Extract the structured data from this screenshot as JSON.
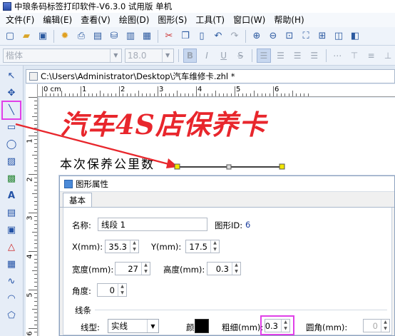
{
  "window": {
    "title": "中琅条码标签打印软件-V6.3.0 试用版 单机"
  },
  "menu": [
    "文件(F)",
    "编辑(E)",
    "查看(V)",
    "绘图(D)",
    "图形(S)",
    "工具(T)",
    "窗口(W)",
    "帮助(H)"
  ],
  "toolbar": {
    "icons": [
      "new-icon",
      "open-icon",
      "save-icon",
      "settings-icon",
      "print-icon",
      "print-preview-icon",
      "database-icon",
      "export-icon",
      "grid-icon",
      "cut-icon",
      "copy-icon",
      "paste-icon",
      "undo-icon",
      "redo-icon",
      "zoom-in-icon",
      "zoom-out-icon",
      "zoom-fit-icon",
      "zoom-page-icon",
      "zoom-actual-icon"
    ]
  },
  "format_bar": {
    "font_name": "楷体",
    "font_size": "18.0",
    "bold": "B",
    "italic": "I",
    "underline": "U",
    "strike": "S"
  },
  "document": {
    "tab_title": "C:\\Users\\Administrator\\Desktop\\汽车维修卡.zhl *"
  },
  "ruler": {
    "unit": "cm",
    "labels": [
      "0",
      "1",
      "2",
      "3",
      "4",
      "5",
      "6"
    ],
    "v_labels": [
      "1",
      "2",
      "3",
      "4",
      "5",
      "6"
    ]
  },
  "label": {
    "title": "汽车4S店保养卡",
    "line1_text": "本次保养公里数"
  },
  "dialog": {
    "title": "图形属性",
    "tab": "基本",
    "name_label": "名称:",
    "name_value": "线段 1",
    "id_label": "图形ID:",
    "id_value": "6",
    "x_label": "X(mm):",
    "x_value": "35.3",
    "y_label": "Y(mm):",
    "y_value": "17.5",
    "width_label": "宽度(mm):",
    "width_value": "27",
    "height_label": "高度(mm):",
    "height_value": "0.3",
    "angle_label": "角度:",
    "angle_value": "0",
    "line_group": "线条",
    "line_type_label": "线型:",
    "line_type_value": "实线",
    "color_label": "颜色:",
    "color_value": "#000000",
    "thickness_label": "粗细(mm):",
    "thickness_value": "0.3",
    "corner_label": "圆角(mm):",
    "corner_value": "0"
  },
  "colors": {
    "title_red": "#e8262c",
    "highlight": "#e040e8"
  }
}
